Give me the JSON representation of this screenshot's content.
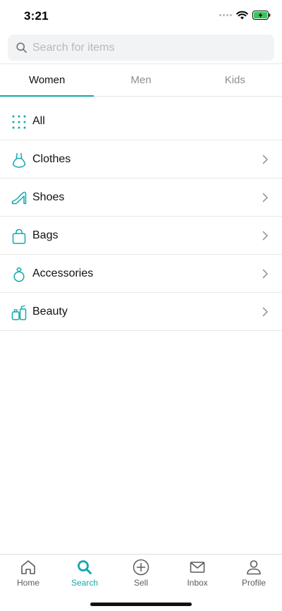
{
  "status_bar": {
    "time": "3:21",
    "icons": [
      "cellular-signal-icon",
      "wifi-icon",
      "battery-charging-icon"
    ]
  },
  "search": {
    "placeholder": "Search for items",
    "value": "",
    "icon": "search-icon"
  },
  "tabs": [
    {
      "label": "Women",
      "active": true
    },
    {
      "label": "Men",
      "active": false
    },
    {
      "label": "Kids",
      "active": false
    }
  ],
  "categories": [
    {
      "label": "All",
      "icon": "grid-dots-icon",
      "has_chevron": false
    },
    {
      "label": "Clothes",
      "icon": "dress-icon",
      "has_chevron": true
    },
    {
      "label": "Shoes",
      "icon": "high-heel-icon",
      "has_chevron": true
    },
    {
      "label": "Bags",
      "icon": "bag-icon",
      "has_chevron": true
    },
    {
      "label": "Accessories",
      "icon": "ring-icon",
      "has_chevron": true
    },
    {
      "label": "Beauty",
      "icon": "perfume-icon",
      "has_chevron": true
    }
  ],
  "bottom_nav": [
    {
      "label": "Home",
      "icon": "home-icon",
      "active": false
    },
    {
      "label": "Search",
      "icon": "search-icon",
      "active": true
    },
    {
      "label": "Sell",
      "icon": "plus-circle-icon",
      "active": false
    },
    {
      "label": "Inbox",
      "icon": "envelope-icon",
      "active": false
    },
    {
      "label": "Profile",
      "icon": "person-icon",
      "active": false
    }
  ],
  "colors": {
    "accent": "#13a8ac",
    "text": "#111111",
    "muted": "#8e8e8e",
    "divider": "#e8e8e8",
    "search_bg": "#f2f3f4",
    "battery": "#34c759"
  }
}
